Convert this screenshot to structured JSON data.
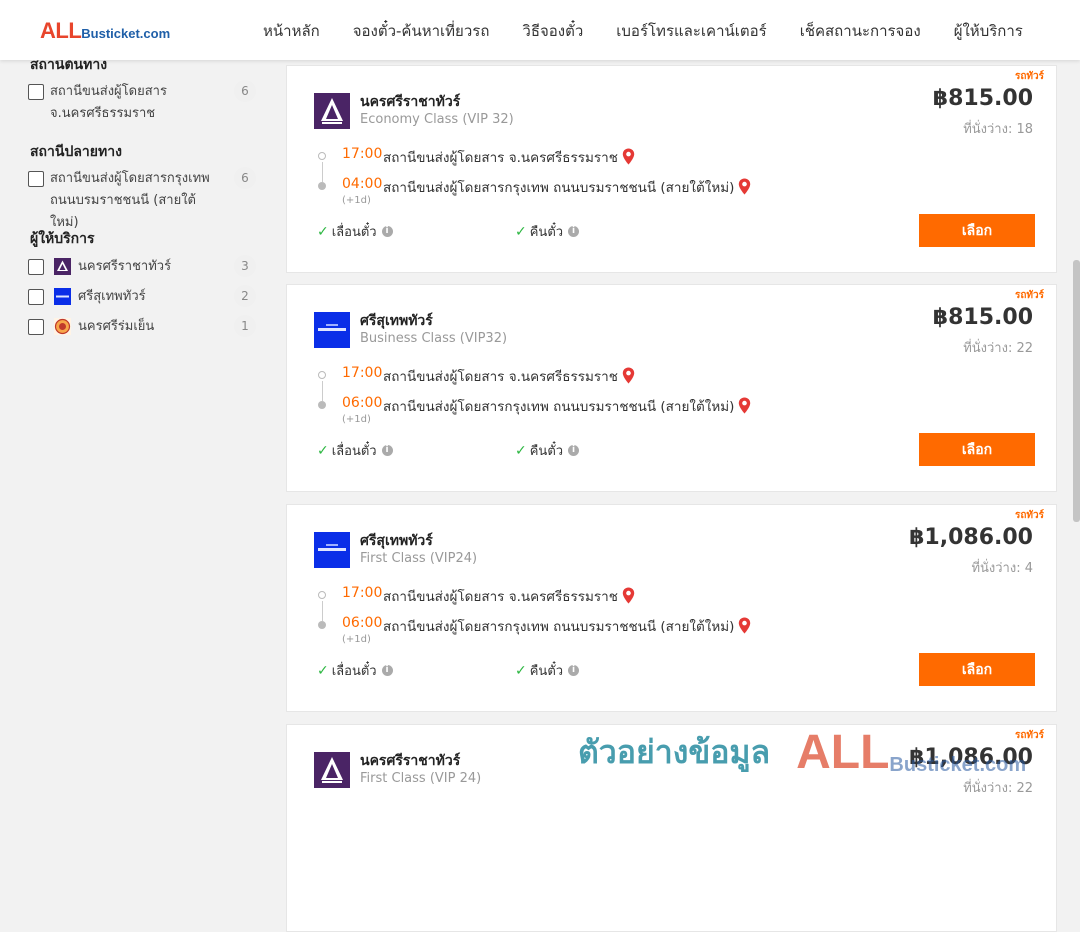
{
  "header": {
    "logo_all": "ALL",
    "logo_rest": "Busticket.com",
    "nav": [
      "หน้าหลัก",
      "จองตั๋ว-ค้นหาเที่ยวรถ",
      "วิธีจองตั๋ว",
      "เบอร์โทรและเคาน์เตอร์",
      "เช็คสถานะการจอง",
      "ผู้ให้บริการ"
    ]
  },
  "sidebar": {
    "origin_title": "สถานีต้นทาง",
    "origin_items": [
      {
        "label": "สถานีขนส่งผู้โดยสาร จ.นครศรีธรรมราช",
        "count": "6"
      }
    ],
    "dest_title": "สถานีปลายทาง",
    "dest_items": [
      {
        "label": "สถานีขนส่งผู้โดยสารกรุงเทพ ถนนบรมราชชนนี (สายใต้ใหม่)",
        "count": "6"
      }
    ],
    "operator_title": "ผู้ให้บริการ",
    "operators": [
      {
        "label": "นครศรีราชาทัวร์",
        "count": "3"
      },
      {
        "label": "ศรีสุเทพทัวร์",
        "count": "2"
      },
      {
        "label": "นครศรีร่มเย็น",
        "count": "1"
      }
    ]
  },
  "trips": [
    {
      "tag": "รถทัวร์",
      "operator": "นครศรีราชาทัวร์",
      "class": "Economy Class (VIP 32)",
      "price": "฿815.00",
      "seats": "ที่นั่งว่าง: 18",
      "dep_time": "17:00",
      "dep_station": "สถานีขนส่งผู้โดยสาร จ.นครศรีธรรมราช",
      "arr_time": "04:00",
      "arr_station": "สถานีขนส่งผู้โดยสารกรุงเทพ ถนนบรมราชชนนี (สายใต้ใหม่)",
      "day_offset": "(+1d)",
      "policy1": "เลื่อนตั๋ว",
      "policy2": "คืนตั๋ว",
      "button": "เลือก"
    },
    {
      "tag": "รถทัวร์",
      "operator": "ศรีสุเทพทัวร์",
      "class": "Business Class (VIP32)",
      "price": "฿815.00",
      "seats": "ที่นั่งว่าง: 22",
      "dep_time": "17:00",
      "dep_station": "สถานีขนส่งผู้โดยสาร จ.นครศรีธรรมราช",
      "arr_time": "06:00",
      "arr_station": "สถานีขนส่งผู้โดยสารกรุงเทพ ถนนบรมราชชนนี (สายใต้ใหม่)",
      "day_offset": "(+1d)",
      "policy1": "เลื่อนตั๋ว",
      "policy2": "คืนตั๋ว",
      "button": "เลือก"
    },
    {
      "tag": "รถทัวร์",
      "operator": "ศรีสุเทพทัวร์",
      "class": "First Class (VIP24)",
      "price": "฿1,086.00",
      "seats": "ที่นั่งว่าง: 4",
      "dep_time": "17:00",
      "dep_station": "สถานีขนส่งผู้โดยสาร จ.นครศรีธรรมราช",
      "arr_time": "06:00",
      "arr_station": "สถานีขนส่งผู้โดยสารกรุงเทพ ถนนบรมราชชนนี (สายใต้ใหม่)",
      "day_offset": "(+1d)",
      "policy1": "เลื่อนตั๋ว",
      "policy2": "คืนตั๋ว",
      "button": "เลือก"
    },
    {
      "tag": "รถทัวร์",
      "operator": "นครศรีราชาทัวร์",
      "class": "First Class (VIP 24)",
      "price": "฿1,086.00",
      "seats": "ที่นั่งว่าง: 22"
    }
  ],
  "watermark": {
    "text": "ตัวอย่างข้อมูล",
    "logo_all": "ALL",
    "logo_rest": "Busticket.com"
  },
  "colors": {
    "accent": "#ff6a00",
    "logo_red": "#e8452c",
    "logo_blue": "#1f5fa8",
    "check_green": "#2db742",
    "pin_red": "#e53935",
    "nakhonsi_purple": "#4a2465",
    "srisuthep_blue": "#0a2ee8"
  },
  "icons": [
    "nakhonsi-logo-icon",
    "srisuthep-logo-icon",
    "romyen-logo-icon",
    "location-pin-icon",
    "check-icon",
    "info-icon"
  ]
}
